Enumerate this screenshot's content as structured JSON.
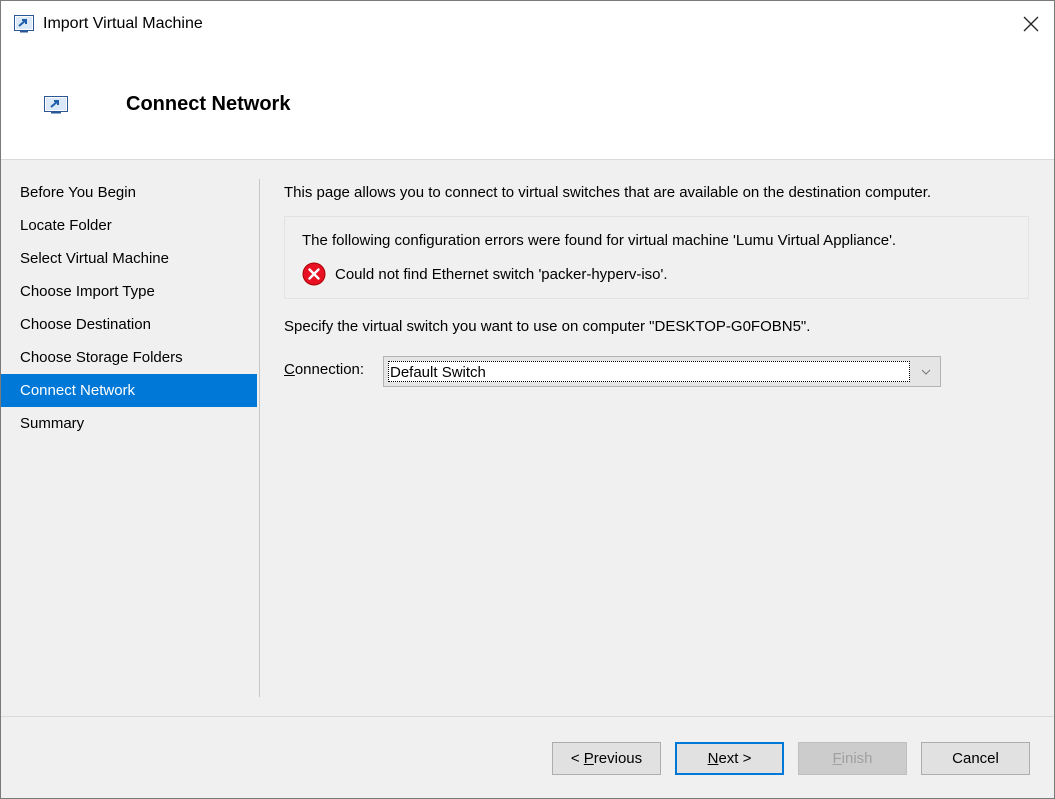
{
  "window": {
    "title": "Import Virtual Machine"
  },
  "header": {
    "title": "Connect Network"
  },
  "nav": {
    "items": [
      {
        "label": "Before You Begin"
      },
      {
        "label": "Locate Folder"
      },
      {
        "label": "Select Virtual Machine"
      },
      {
        "label": "Choose Import Type"
      },
      {
        "label": "Choose Destination"
      },
      {
        "label": "Choose Storage Folders"
      },
      {
        "label": "Connect Network"
      },
      {
        "label": "Summary"
      }
    ],
    "active": "Connect Network"
  },
  "content": {
    "intro": "This page allows you to connect to virtual switches that are available on the destination computer.",
    "errors_heading": "The following configuration errors were found for virtual machine 'Lumu Virtual Appliance'.",
    "error_message": "Could not find Ethernet switch 'packer-hyperv-iso'.",
    "specify_text": "Specify the virtual switch you want to use on computer \"DESKTOP-G0FOBN5\".",
    "connection_label_prefix": "C",
    "connection_label_rest": "onnection:",
    "connection_value": "Default Switch"
  },
  "buttons": {
    "previous_prefix": "< ",
    "previous_accel": "P",
    "previous_rest": "revious",
    "next_accel": "N",
    "next_rest": "ext >",
    "finish_accel": "F",
    "finish_rest": "inish",
    "cancel": "Cancel"
  },
  "colors": {
    "accent": "#0078d7",
    "error": "#e81123"
  }
}
